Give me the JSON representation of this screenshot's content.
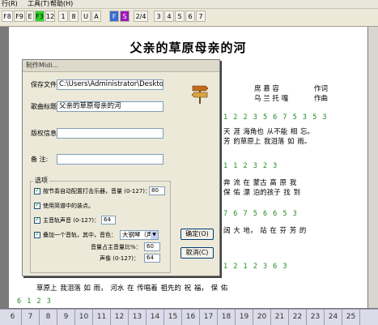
{
  "menu": {
    "items": [
      "行(R)",
      "工具(T)",
      "帮助(H)"
    ]
  },
  "toolbar": {
    "buttons": [
      "F8",
      "F9",
      "E",
      "F3",
      "12",
      "1",
      "8",
      "U",
      "A",
      "F",
      "S",
      "2/4",
      "3",
      "4",
      "5",
      "6",
      "7"
    ]
  },
  "song": {
    "title": "父亲的草原母亲的河",
    "credits": [
      {
        "role": "作词",
        "name": "席 慕 容"
      },
      {
        "role": "作曲",
        "name": "乌 兰 托 嘎"
      }
    ],
    "score_lines": [
      "1 2 2 3 5 6 7 5 3 5 3",
      "1 1 2 3 2 3",
      "7 6 7 5 6 6 5 3",
      "1 2 1 2 3 6 3",
      "6 1 2 3"
    ],
    "lyric_lines": [
      "天 涯 海角也  从不能 相 忘。",
      "芳 的草原上  我泪落 如 雨。",
      "奔 流  在      蒙古 高  原 我",
      "保 佑  漂      泊的孩子 找 到",
      "阔 大 地，        站 在 芬 芳 的",
      "草原上  我泪落  如  雨，    河水        在    传唱着    祖先的 祝 福，      保       佑"
    ]
  },
  "dialog": {
    "title": "制作Midi...",
    "save_file_label": "保存文件:",
    "save_file_value": "C:\\Users\\Administrator\\Deskto",
    "song_title_label": "歌曲标题:",
    "song_title_value": "父亲的草原母亲的河",
    "copyright_label": "版权信息:",
    "copyright_value": "",
    "note_label": "备    注:",
    "note_value": "",
    "options_legend": "选项",
    "options": [
      {
        "label": "按节奏自动配置打击乐器，音量 (0-127)：",
        "value": "80",
        "checked": true
      },
      {
        "label": "使用简谱中的装点。",
        "checked": true
      },
      {
        "label": "主音轨声音 (0-127)：",
        "value": "64",
        "checked": true
      },
      {
        "label": "叠加一个音轨，其中，音色：",
        "value": "大钢琴（声号",
        "checked": true
      }
    ],
    "ratio_label": "音量占主音量比%：",
    "ratio_value": "60",
    "pan_label": "声像 (0-127)：",
    "pan_value": "64",
    "ok_label": "确定(O)",
    "cancel_label": "取消(C)",
    "icon": "signpost-icon"
  },
  "ruler": {
    "numbers": [
      "6",
      "7",
      "8",
      "9",
      "10",
      "11",
      "12",
      "13",
      "14",
      "15",
      "16",
      "17",
      "18",
      "19",
      "20",
      "21",
      "22",
      "23",
      "24",
      "25"
    ]
  }
}
